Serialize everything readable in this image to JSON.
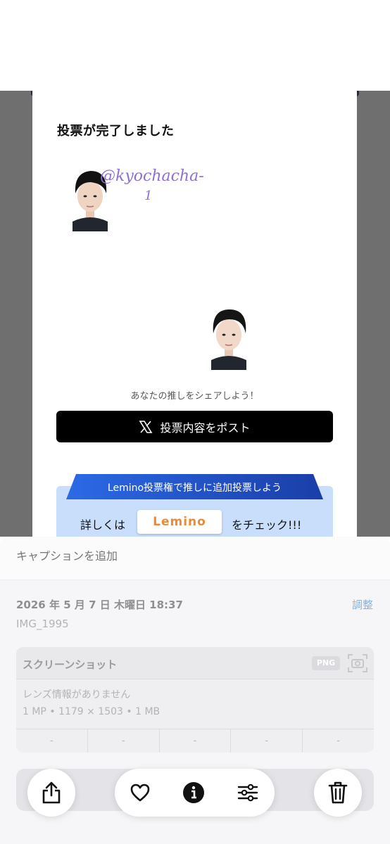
{
  "card": {
    "title": "投票が完了しました",
    "handwriting_line1": "@kyochacha-",
    "handwriting_line2": "1",
    "share_hint": "あなたの推しをシェアしよう！",
    "post_button_label": "投票内容をポスト",
    "promo": {
      "banner_text": "Lemino投票権で推しに追加投票しよう",
      "left_text": "詳しくは",
      "logo_text": "Lemino",
      "right_text": "をチェック!!!"
    }
  },
  "info": {
    "caption_placeholder": "キャプションを追加",
    "date": "2026 年 5 月 7 日 木曜日 18:37",
    "adjust_label": "調整",
    "filename": "IMG_1995",
    "meta": {
      "title": "スクリーンショット",
      "format_badge": "PNG",
      "lens_text": "レンズ情報がありません",
      "spec_text": "1 MP  •  1179 × 1503  •  1 MB",
      "exif": [
        "-",
        "-",
        "-",
        "-",
        "-"
      ]
    }
  },
  "toolbar": {
    "share_icon": "share-icon",
    "favorite_icon": "heart-icon",
    "info_icon": "info-icon",
    "adjust_icon": "sliders-icon",
    "delete_icon": "trash-icon"
  },
  "colors": {
    "photo_background": "#6f6f6f",
    "promo_box": "#c8defa",
    "promo_banner": "#1a4fd0",
    "lemino_orange": "#e88a3a",
    "handwriting": "#8f6fcf",
    "adjust_link": "#7fb2ea"
  }
}
